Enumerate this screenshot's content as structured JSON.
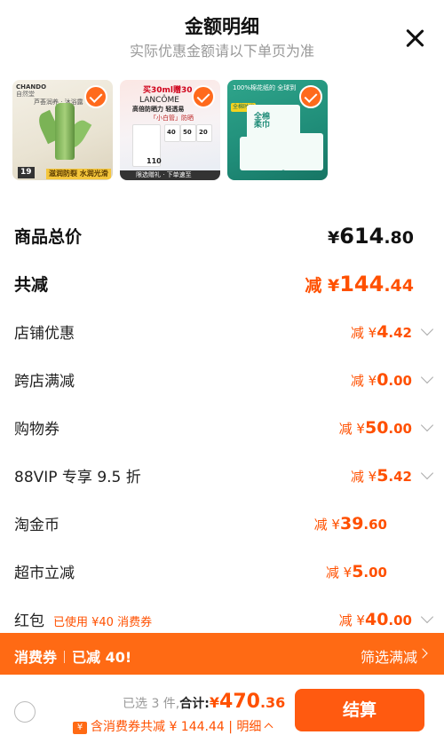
{
  "header": {
    "title": "金额明细",
    "subtitle": "实际优惠金额请以下单页为准"
  },
  "products": [
    {
      "brand": "CHANDO",
      "brand_sub": "自然堂",
      "top_text": "芦荟润养 · 沐浴露",
      "price_badge": "19",
      "banner": "滋润防裂 水润光滑"
    },
    {
      "promo": "买30ml赠30",
      "brand": "LANCÔME",
      "tagline": "高倍防晒力 轻透易",
      "sub": "「小白管」防晒",
      "spf": [
        "40",
        "50",
        "20"
      ],
      "price_badge": "110",
      "bottom": "限选赠礼 · 下单速至"
    },
    {
      "top_text": "100%棉花纸的 全球到",
      "badge": "全棉时代",
      "box_text": "全棉\n柔巾"
    }
  ],
  "rows": {
    "total": {
      "label": "商品总价",
      "prefix": "¥",
      "int": "614",
      "dec": ".80"
    },
    "discount": {
      "label": "共减",
      "prefix": "减 ¥",
      "int": "144",
      "dec": ".44"
    },
    "items": [
      {
        "label": "店铺优惠",
        "prefix": "减 ¥",
        "int": "4",
        "dec": ".42"
      },
      {
        "label": "跨店满减",
        "prefix": "减 ¥",
        "int": "0",
        "dec": ".00"
      },
      {
        "label": "购物券",
        "prefix": "减 ¥",
        "int": "50",
        "dec": ".00"
      },
      {
        "label": "88VIP 专享 9.5 折",
        "prefix": "减 ¥",
        "int": "5",
        "dec": ".42"
      },
      {
        "label": "淘金币",
        "prefix": "减 ¥",
        "int": "39",
        "dec": ".60"
      },
      {
        "label": "超市立减",
        "prefix": "减 ¥",
        "int": "5",
        "dec": ".00"
      },
      {
        "label": "红包",
        "note": "已使用 ¥40 消费券",
        "prefix": "减 ¥",
        "int": "40",
        "dec": ".00"
      }
    ]
  },
  "banner": {
    "left_a": "消费券",
    "left_b": "已减 40!",
    "right": "筛选满减"
  },
  "footer": {
    "selected": "已选 3 件,",
    "total_label": "合计:",
    "currency": "¥",
    "price_int": "470",
    "price_dec": ".36",
    "detail_icon": "¥",
    "detail": "含消费券共减 ¥ 144.44 | 明细",
    "checkout": "结算"
  }
}
